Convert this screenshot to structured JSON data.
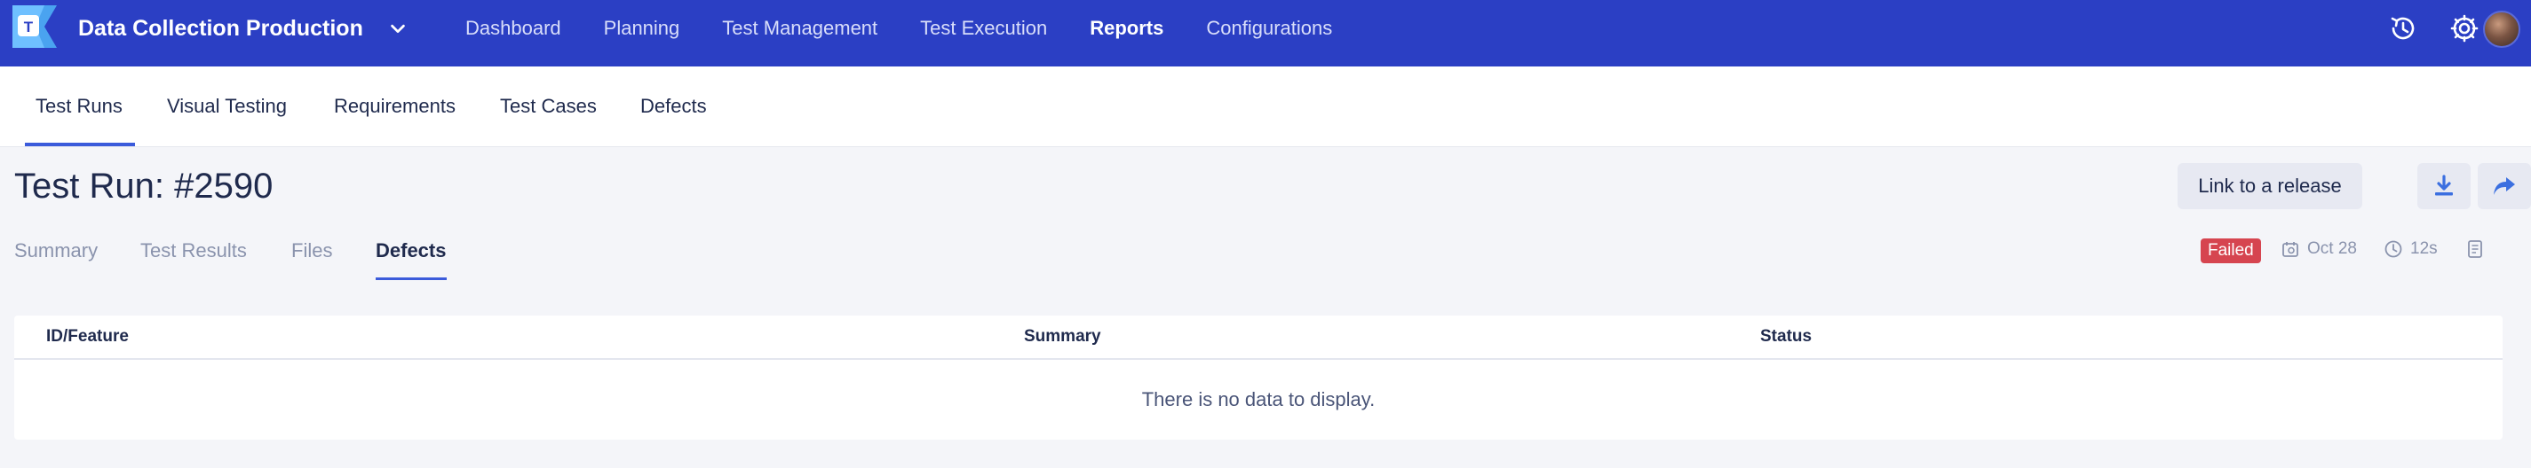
{
  "topbar": {
    "project_name": "Data Collection Production",
    "nav": [
      "Dashboard",
      "Planning",
      "Test Management",
      "Test Execution",
      "Reports",
      "Configurations"
    ],
    "active_nav": "Reports",
    "icons": [
      "history-icon",
      "settings-icon",
      "user-avatar"
    ]
  },
  "subnav": {
    "tabs": [
      "Test Runs",
      "Visual Testing",
      "Requirements",
      "Test Cases",
      "Defects"
    ],
    "active": "Test Runs"
  },
  "header": {
    "title": "Test Run: #2590",
    "link_release_label": "Link to a release"
  },
  "inner_tabs": {
    "tabs": [
      "Summary",
      "Test Results",
      "Files",
      "Defects"
    ],
    "active": "Defects"
  },
  "meta": {
    "status": "Failed",
    "date": "Oct 28",
    "duration": "12s"
  },
  "table": {
    "columns": [
      "ID/Feature",
      "Summary",
      "Status"
    ],
    "empty_message": "There is no data to display."
  },
  "colors": {
    "topbar": "#2b3fc4",
    "accent": "#3b5bdb",
    "failed": "#d64550"
  }
}
